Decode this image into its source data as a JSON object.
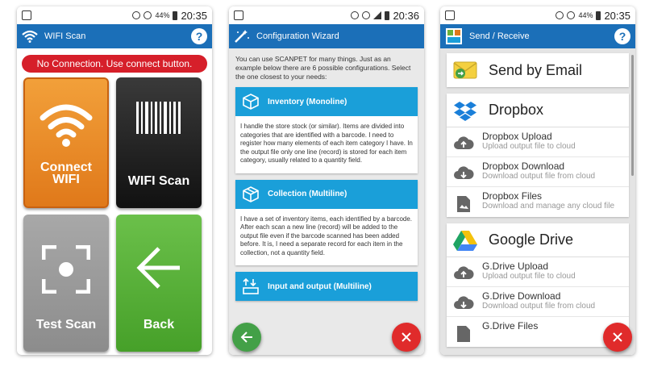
{
  "colors": {
    "primary": "#1b6fb8",
    "danger": "#d61f2a",
    "orange": "#e0791a",
    "green": "#46a029",
    "card_header": "#1a9fd9"
  },
  "phone1": {
    "status": {
      "battery": "44%",
      "time": "20:35"
    },
    "appbar": {
      "title": "WIFI Scan",
      "help_icon": "question-icon"
    },
    "banner": "No Connection. Use connect button.",
    "tiles": [
      {
        "label": "Connect\nWIFI",
        "icon": "wifi-icon"
      },
      {
        "label": "WIFI Scan",
        "icon": "barcode-icon"
      },
      {
        "label": "Test Scan",
        "icon": "scan-frame-icon"
      },
      {
        "label": "Back",
        "icon": "arrow-left-icon"
      }
    ]
  },
  "phone2": {
    "status": {
      "time": "20:36"
    },
    "appbar": {
      "title": "Configuration Wizard",
      "icon": "magic-wand-icon"
    },
    "intro": "You can use SCANPET for many things. Just as an example below there are 6 possible configurations. Select the one closest to your needs:",
    "cards": [
      {
        "title": "Inventory (Monoline)",
        "icon": "cube-icon",
        "body": "I handle the store stock (or similar). Items are divided into categories that are identified with a barcode. I need to register how many elements of each item category I have. In the output file only one line (record) is stored for each item category, usually related to a quantity field."
      },
      {
        "title": "Collection (Multiline)",
        "icon": "cube-outline-icon",
        "body": "I have a set of inventory items, each identified by a barcode. After each scan a new line (record) will be added to the output file even if the barcode scanned has been added before. It is, I need a separate record for each item in the collection, not a quantity field."
      },
      {
        "title": "Input and output (Multiline)",
        "icon": "in-out-icon",
        "body": ""
      }
    ]
  },
  "phone3": {
    "status": {
      "battery": "44%",
      "time": "20:35"
    },
    "appbar": {
      "title": "Send / Receive",
      "help_icon": "question-icon"
    },
    "email": {
      "title": "Send by Email",
      "icon": "email-icon"
    },
    "dropbox": {
      "title": "Dropbox",
      "icon": "dropbox-icon",
      "rows": [
        {
          "title": "Dropbox Upload",
          "sub": "Upload output file to cloud",
          "icon": "cloud-upload-icon"
        },
        {
          "title": "Dropbox Download",
          "sub": "Download output file from cloud",
          "icon": "cloud-download-icon"
        },
        {
          "title": "Dropbox Files",
          "sub": "Download and manage any cloud file",
          "icon": "file-icon"
        }
      ]
    },
    "gdrive": {
      "title": "Google Drive",
      "icon": "google-drive-icon",
      "rows": [
        {
          "title": "G.Drive Upload",
          "sub": "Upload output file to cloud",
          "icon": "cloud-upload-icon"
        },
        {
          "title": "G.Drive Download",
          "sub": "Download output file from cloud",
          "icon": "cloud-download-icon"
        },
        {
          "title": "G.Drive Files",
          "sub": "",
          "icon": "file-icon"
        }
      ]
    }
  }
}
